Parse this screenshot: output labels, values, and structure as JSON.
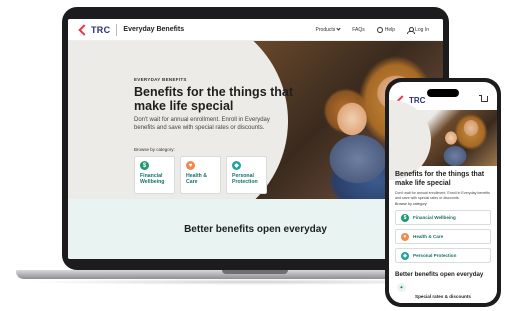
{
  "desktop": {
    "header": {
      "logo_text": "TRC",
      "site_name": "Everyday Benefits",
      "nav": [
        "Products",
        "FAQs",
        "Help",
        "Log In"
      ]
    },
    "hero": {
      "eyebrow": "EVERYDAY BENEFITS",
      "title": "Benefits for the things that make life special",
      "description": "Don't wait for annual enrollment. Enroll in Everyday benefits and save with special rates or discounts.",
      "browse_label": "Browse by category:",
      "categories": [
        {
          "label": "Financial Wellbeing",
          "icon": "dollar-icon",
          "color": "#1f9a6e"
        },
        {
          "label": "Health & Care",
          "icon": "heart-icon",
          "color": "#f08a4b"
        },
        {
          "label": "Personal Protection",
          "icon": "shield-icon",
          "color": "#1fa3a0"
        }
      ]
    },
    "band": {
      "title": "Better benefits open everyday"
    }
  },
  "mobile": {
    "logo_text": "TRC",
    "title": "Benefits for the things that make life special",
    "description": "Don't wait for annual enrollment. Enroll in Everyday benefits and save with special rates or discounts.",
    "browse_label": "Browse by category:",
    "categories": [
      "Financial Wellbeing",
      "Health & Care",
      "Personal Protection"
    ],
    "band_title": "Better benefits open everyday",
    "band_subtitle": "Special rates & discounts"
  },
  "colors": {
    "brand_navy": "#2c2f7a",
    "brand_red": "#e8334a",
    "teal": "#1b6f6a",
    "band_bg": "#e9f4f2"
  }
}
